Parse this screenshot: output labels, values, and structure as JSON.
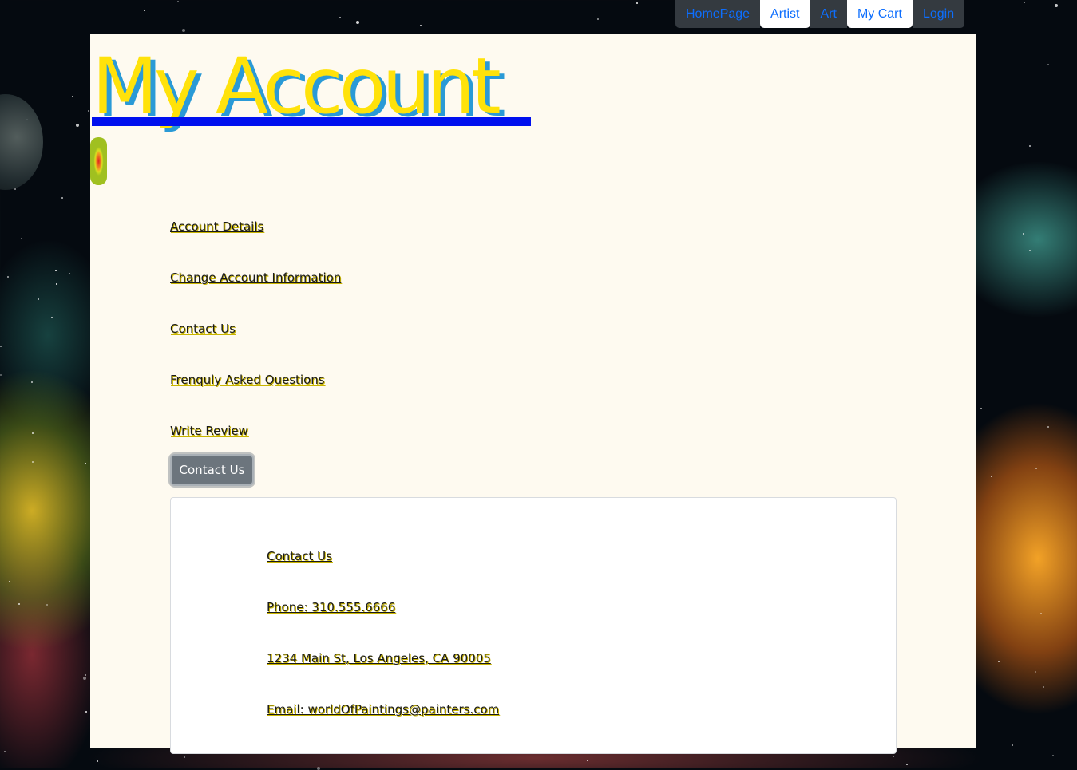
{
  "nav": {
    "items": [
      "HomePage",
      "Artist",
      "Art",
      "My Cart",
      "Login"
    ]
  },
  "page": {
    "title": "My Account"
  },
  "sidebar": {
    "links": [
      "Account Details",
      "Change Account Information",
      "Contact Us",
      "Frenquly Asked Questions",
      "Write Review"
    ]
  },
  "contact_button": {
    "label": "Contact Us"
  },
  "contact_card": {
    "lines": [
      "Contact Us",
      "Phone: 310.555.6666",
      "1234 Main St, Los Angeles, CA 90005",
      "Email: worldOfPaintings@painters.com"
    ]
  },
  "colors": {
    "title_fill": "#ffe20a",
    "title_shadow": "#2a9ad6",
    "nav_dark": "#343a40",
    "nav_link": "#0d6efd",
    "panel_bg": "#fefaf0",
    "button_bg": "#6c757d"
  }
}
